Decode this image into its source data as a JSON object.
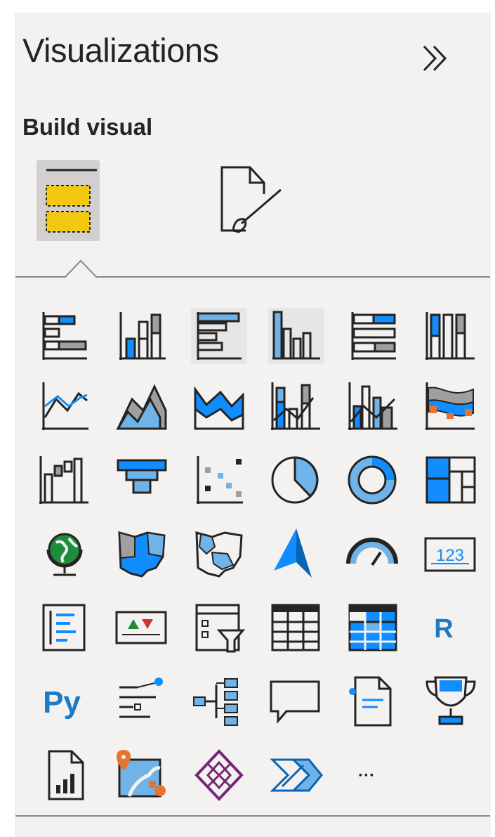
{
  "panel": {
    "title": "Visualizations",
    "expand_icon": "double-chevron-right-icon",
    "subtitle": "Build visual",
    "tabs": [
      {
        "name": "build-visual",
        "icon": "fields-well-icon",
        "selected": true
      },
      {
        "name": "format-visual",
        "icon": "format-paintbrush-icon",
        "selected": false
      }
    ]
  },
  "visuals": [
    [
      "stacked-bar-chart-icon",
      "stacked-column-chart-icon",
      "clustered-bar-chart-icon",
      "clustered-column-chart-icon",
      "100-stacked-bar-chart-icon",
      "100-stacked-column-chart-icon"
    ],
    [
      "line-chart-icon",
      "area-chart-icon",
      "stacked-area-chart-icon",
      "line-and-stacked-column-chart-icon",
      "line-and-clustered-column-chart-icon",
      "ribbon-chart-icon"
    ],
    [
      "waterfall-chart-icon",
      "funnel-icon",
      "scatter-chart-icon",
      "pie-chart-icon",
      "donut-chart-icon",
      "treemap-icon"
    ],
    [
      "map-icon",
      "filled-map-icon",
      "shape-map-icon",
      "azure-map-icon",
      "gauge-icon",
      "card-icon"
    ],
    [
      "multi-row-card-icon",
      "kpi-icon",
      "slicer-icon",
      "table-icon",
      "matrix-icon",
      "r-script-visual-icon"
    ],
    [
      "python-visual-icon",
      "key-influencers-icon",
      "decomposition-tree-icon",
      "qa-icon",
      "smart-narrative-icon",
      "metrics-icon"
    ],
    [
      "paginated-report-icon",
      "arcgis-map-icon",
      "power-apps-icon",
      "power-automate-icon",
      "more-visuals-icon"
    ]
  ],
  "text_glyphs": {
    "r": "R",
    "py": "Py",
    "card": "123",
    "more": "···"
  },
  "colors": {
    "blue": "#118dff",
    "light_blue": "#6fb3e8",
    "dark": "#252423",
    "gray": "#a19f9d",
    "yellow": "#f2c811",
    "orange": "#e8732a",
    "purple": "#742774",
    "green": "#1e8c3a"
  }
}
